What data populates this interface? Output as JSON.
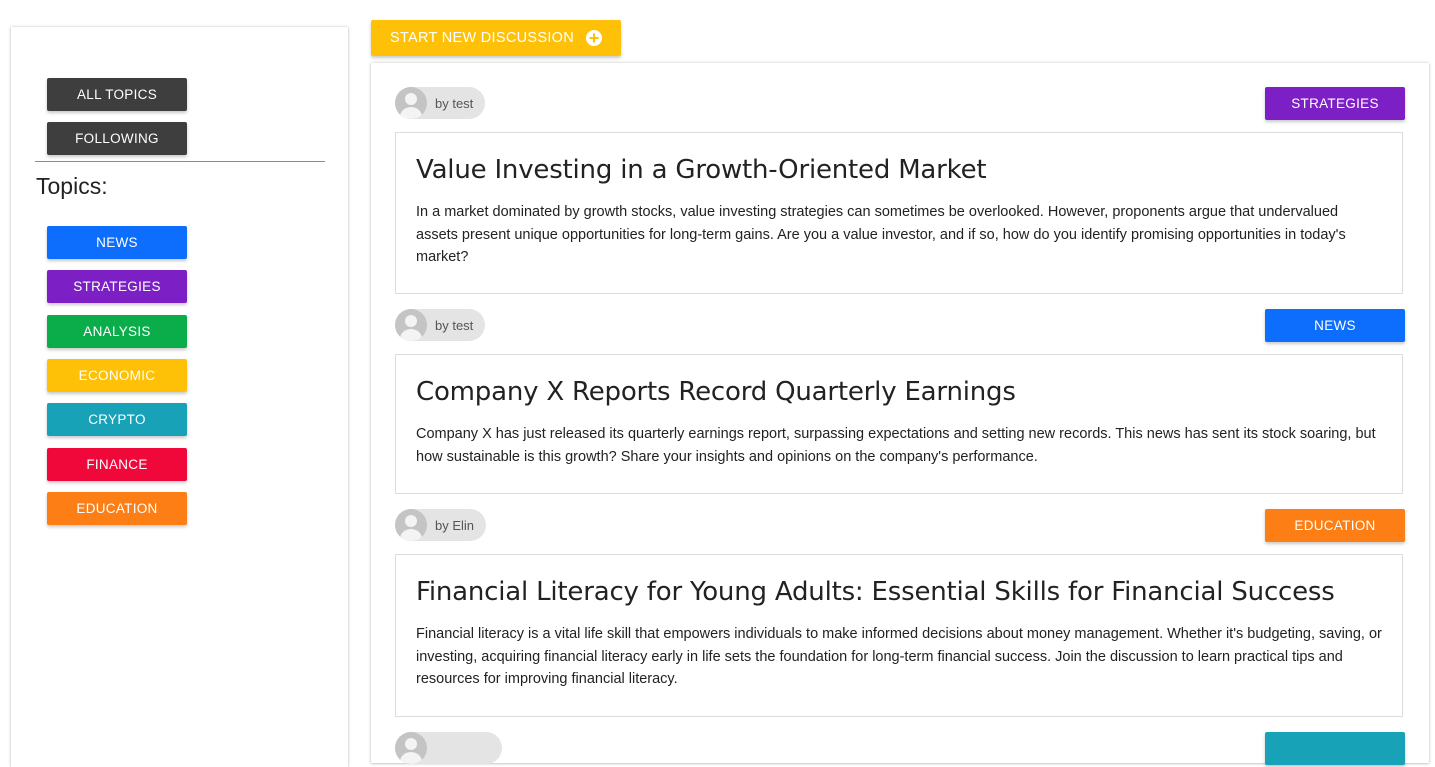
{
  "actions": {
    "new_discussion_label": "START NEW DISCUSSION"
  },
  "sidebar": {
    "all_topics_label": "ALL TOPICS",
    "following_label": "FOLLOWING",
    "topics_heading": "Topics:",
    "topics": [
      {
        "label": "NEWS",
        "color": "#0d6efd"
      },
      {
        "label": "STRATEGIES",
        "color": "#7c1fc4"
      },
      {
        "label": "ANALYSIS",
        "color": "#0aad4a"
      },
      {
        "label": "ECONOMIC",
        "color": "#ffc107"
      },
      {
        "label": "CRYPTO",
        "color": "#17a2b8"
      },
      {
        "label": "FINANCE",
        "color": "#f0083a"
      },
      {
        "label": "EDUCATION",
        "color": "#fd7e14"
      }
    ]
  },
  "discussions": [
    {
      "author": "by test",
      "topic": "STRATEGIES",
      "topic_color": "#7c1fc4",
      "title": "Value Investing in a Growth-Oriented Market",
      "body": "In a market dominated by growth stocks, value investing strategies can sometimes be overlooked. However, proponents argue that undervalued assets present unique opportunities for long-term gains. Are you a value investor, and if so, how do you identify promising opportunities in today's market?"
    },
    {
      "author": "by test",
      "topic": "NEWS",
      "topic_color": "#0d6efd",
      "title": "Company X Reports Record Quarterly Earnings",
      "body": "Company X has just released its quarterly earnings report, surpassing expectations and setting new records. This news has sent its stock soaring, but how sustainable is this growth? Share your insights and opinions on the company's performance."
    },
    {
      "author": "by Elin",
      "topic": "EDUCATION",
      "topic_color": "#fd7e14",
      "title": "Financial Literacy for Young Adults: Essential Skills for Financial Success",
      "body": "Financial literacy is a vital life skill that empowers individuals to make informed decisions about money management. Whether it's budgeting, saving, or investing, acquiring financial literacy early in life sets the foundation for long-term financial success. Join the discussion to learn practical tips and resources for improving financial literacy."
    },
    {
      "author": "",
      "topic": "",
      "topic_color": "#17a2b8",
      "title": "",
      "body": ""
    }
  ]
}
